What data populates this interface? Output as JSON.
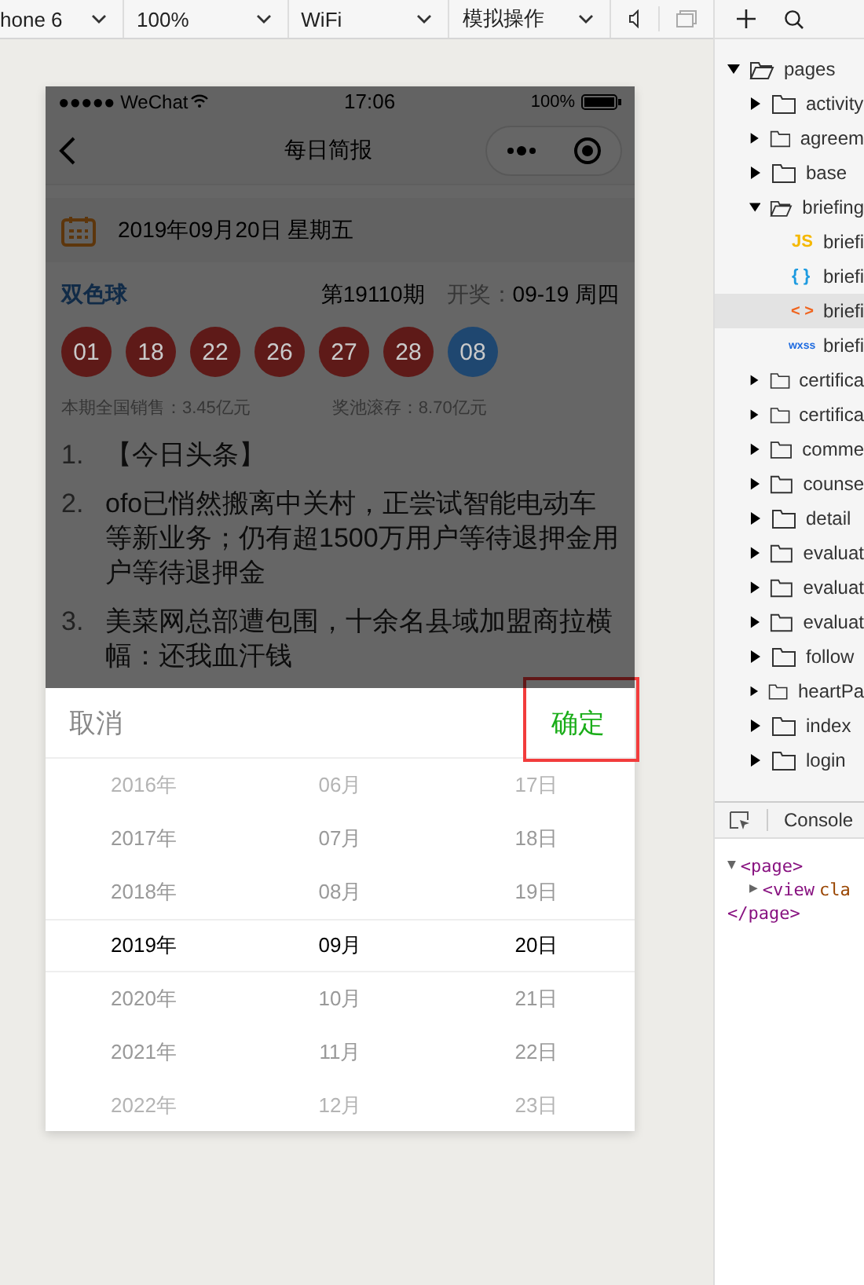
{
  "toolbar": {
    "dropdowns": [
      {
        "label": "hone 6"
      },
      {
        "label": "100%"
      },
      {
        "label": "WiFi"
      },
      {
        "label": "模拟操作"
      }
    ]
  },
  "phone": {
    "status_bar": {
      "carrier": "●●●●● WeChat",
      "time": "17:06",
      "battery": "100%"
    },
    "nav_bar": {
      "title": "每日简报"
    },
    "date_bar": {
      "date": "2019年09月20日 星期五"
    },
    "lottery": {
      "name": "双色球",
      "issue": "第19110期",
      "draw_label": "开奖：",
      "draw_date": "09-19 周四",
      "balls": [
        {
          "number": "01",
          "color": "#5e1a18"
        },
        {
          "number": "18",
          "color": "#5e1a18"
        },
        {
          "number": "22",
          "color": "#5e1a18"
        },
        {
          "number": "26",
          "color": "#5e1a18"
        },
        {
          "number": "27",
          "color": "#5e1a18"
        },
        {
          "number": "28",
          "color": "#5e1a18"
        },
        {
          "number": "08",
          "color": "#1f4770"
        }
      ],
      "sales": "本期全国销售：3.45亿元",
      "pool": "奖池滚存：8.70亿元"
    },
    "news": [
      {
        "number": "1.",
        "text": "【今日头条】"
      },
      {
        "number": "2.",
        "text": "ofo已悄然搬离中关村，正尝试智能电动车等新业务；仍有超1500万用户等待退押金用户等待退押金"
      },
      {
        "number": "3.",
        "text": "美菜网总部遭包围，十余名县域加盟商拉横幅：还我血汗钱"
      }
    ]
  },
  "picker": {
    "cancel": "取消",
    "confirm": "确定",
    "confirm_highlighted": true,
    "columns": [
      {
        "items": [
          {
            "label": "2016年",
            "selected": false
          },
          {
            "label": "2017年",
            "selected": false
          },
          {
            "label": "2018年",
            "selected": false
          },
          {
            "label": "2019年",
            "selected": true
          },
          {
            "label": "2020年",
            "selected": false
          },
          {
            "label": "2021年",
            "selected": false
          },
          {
            "label": "2022年",
            "selected": false
          }
        ]
      },
      {
        "items": [
          {
            "label": "06月",
            "selected": false
          },
          {
            "label": "07月",
            "selected": false
          },
          {
            "label": "08月",
            "selected": false
          },
          {
            "label": "09月",
            "selected": true
          },
          {
            "label": "10月",
            "selected": false
          },
          {
            "label": "11月",
            "selected": false
          },
          {
            "label": "12月",
            "selected": false
          }
        ]
      },
      {
        "items": [
          {
            "label": "17日",
            "selected": false
          },
          {
            "label": "18日",
            "selected": false
          },
          {
            "label": "19日",
            "selected": false
          },
          {
            "label": "20日",
            "selected": true
          },
          {
            "label": "21日",
            "selected": false
          },
          {
            "label": "22日",
            "selected": false
          },
          {
            "label": "23日",
            "selected": false
          }
        ]
      }
    ]
  },
  "file_tree": {
    "items": [
      {
        "kind": "folder",
        "label": "pages",
        "expanded": true,
        "selected": false,
        "children": [
          {
            "kind": "folder",
            "label": "activity",
            "expanded": false,
            "selected": false
          },
          {
            "kind": "folder",
            "label": "agreem",
            "expanded": false,
            "selected": false
          },
          {
            "kind": "folder",
            "label": "base",
            "expanded": false,
            "selected": false
          },
          {
            "kind": "folder",
            "label": "briefing",
            "expanded": true,
            "selected": false,
            "children": [
              {
                "kind": "js",
                "icon_text": "JS",
                "label": "briefi",
                "selected": false
              },
              {
                "kind": "json",
                "icon_text": "{ }",
                "label": "briefi",
                "selected": false
              },
              {
                "kind": "wxml",
                "icon_text": "< >",
                "label": "briefi",
                "selected": true
              },
              {
                "kind": "wxss",
                "icon_text": "wxss",
                "label": "briefi",
                "selected": false
              }
            ]
          },
          {
            "kind": "folder",
            "label": "certifica",
            "expanded": false,
            "selected": false
          },
          {
            "kind": "folder",
            "label": "certifica",
            "expanded": false,
            "selected": false
          },
          {
            "kind": "folder",
            "label": "comme",
            "expanded": false,
            "selected": false
          },
          {
            "kind": "folder",
            "label": "counse",
            "expanded": false,
            "selected": false
          },
          {
            "kind": "folder",
            "label": "detail",
            "expanded": false,
            "selected": false
          },
          {
            "kind": "folder",
            "label": "evaluat",
            "expanded": false,
            "selected": false
          },
          {
            "kind": "folder",
            "label": "evaluat",
            "expanded": false,
            "selected": false
          },
          {
            "kind": "folder",
            "label": "evaluat",
            "expanded": false,
            "selected": false
          },
          {
            "kind": "folder",
            "label": "follow",
            "expanded": false,
            "selected": false
          },
          {
            "kind": "folder",
            "label": "heartPa",
            "expanded": false,
            "selected": false
          },
          {
            "kind": "folder",
            "label": "index",
            "expanded": false,
            "selected": false
          },
          {
            "kind": "folder",
            "label": "login",
            "expanded": false,
            "selected": false
          }
        ]
      }
    ]
  },
  "devtools": {
    "tab": "Console",
    "elements": [
      {
        "toggle": "▼",
        "tag": "<page>",
        "children": [
          {
            "toggle": "▶",
            "tag": "<view",
            "attr": "cla"
          }
        ]
      },
      {
        "tag": "</page>"
      }
    ]
  }
}
